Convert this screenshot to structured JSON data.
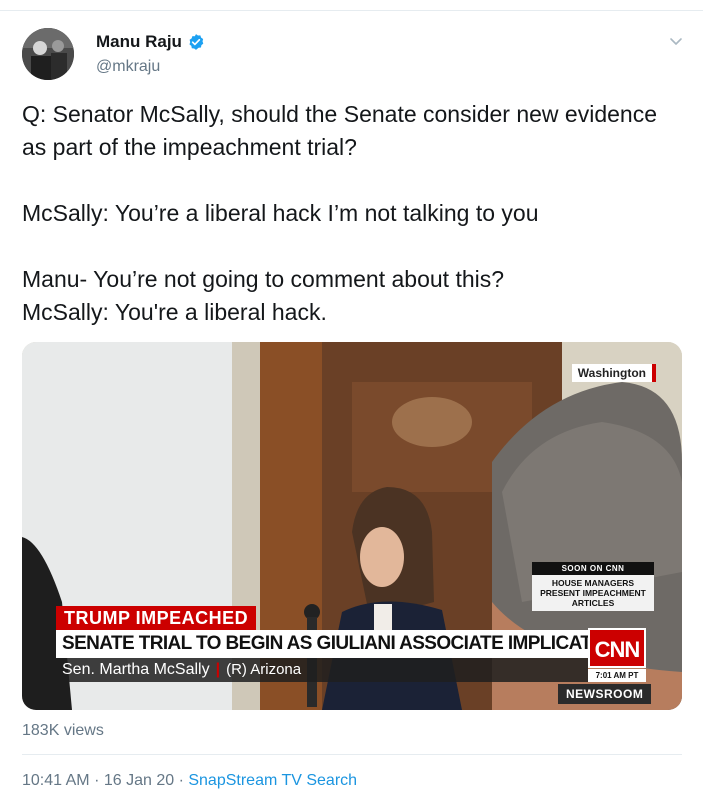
{
  "tweet": {
    "author_name": "Manu Raju",
    "handle": "@mkraju",
    "verified": true,
    "text": "Q: Senator McSally, should the Senate consider new evidence as part of the impeachment trial?\n\nMcSally: You’re a liberal hack I’m not talking to you\n\nManu- You’re not going to comment about this?\nMcSally: You're a liberal hack.",
    "views": "183K views",
    "time": "10:41 AM",
    "date": "16 Jan 20",
    "source": "SnapStream TV Search",
    "separator": "·"
  },
  "video": {
    "location_tag": "Washington",
    "soon_label": "SOON ON CNN",
    "soon_text": "HOUSE MANAGERS PRESENT IMPEACHMENT ARTICLES",
    "banner_tag": "TRUMP IMPEACHED",
    "headline": "SENATE TRIAL TO BEGIN AS GIULIANI ASSOCIATE IMPLICATES TRUMP",
    "speaker": "Sen. Martha McSally",
    "speaker_sep": "|",
    "party_state": "(R) Arizona",
    "network_logo": "CNN",
    "clock": "7:01 AM PT",
    "show": "NEWSROOM"
  },
  "icons": {
    "verified": "verified-badge-icon",
    "caret": "chevron-down-icon"
  },
  "colors": {
    "accent_blue": "#1b95e0",
    "cnn_red": "#cc0000",
    "muted_text": "#657786"
  }
}
